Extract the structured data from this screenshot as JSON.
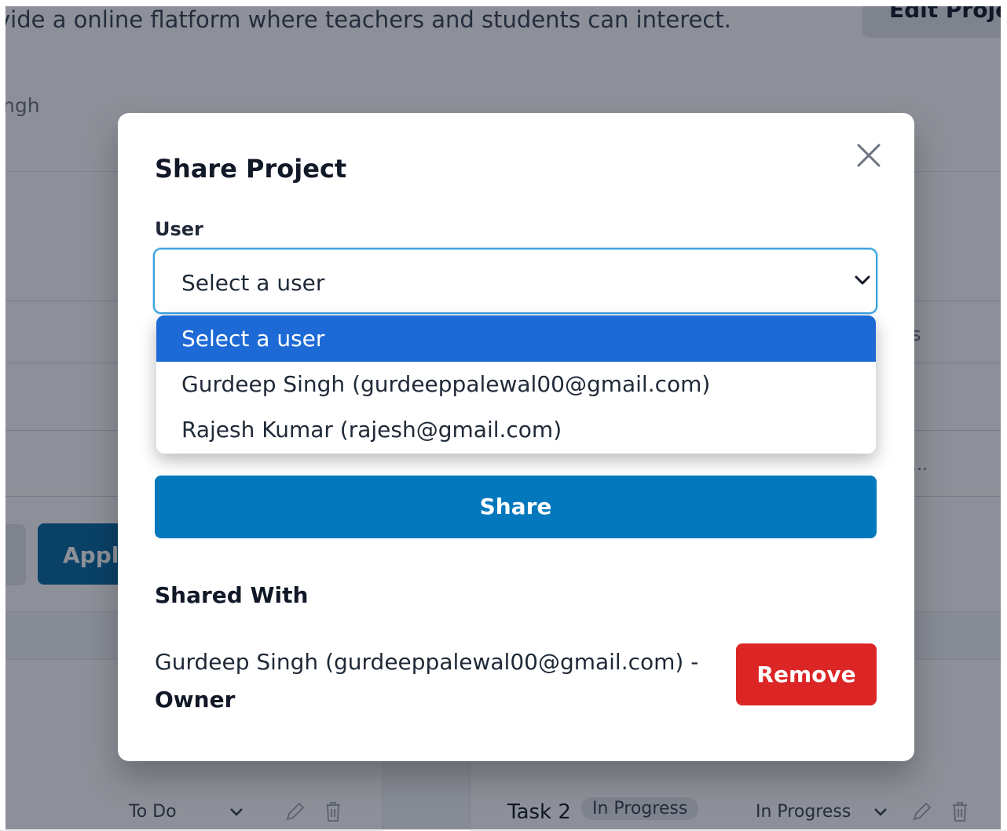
{
  "background": {
    "project_description": "vide a online flatform where teachers and students can interect.",
    "owner_fragment": "ngh",
    "edit_button": "Edit Proje",
    "status_fragment": "s",
    "dots_fragment": "...",
    "apply_button": "Appl",
    "tasks": [
      {
        "status_label": "To Do"
      },
      {
        "name": "Task 2",
        "badge": "In Progress",
        "status_label": "In Progress"
      }
    ]
  },
  "modal": {
    "title": "Share Project",
    "user_label": "User",
    "select": {
      "selected": "Select a user",
      "options": [
        "Select a user",
        "Gurdeep Singh (gurdeeppalewal00@gmail.com)",
        "Rajesh Kumar (rajesh@gmail.com)"
      ]
    },
    "share_button": "Share",
    "shared_with_heading": "Shared With",
    "shared_with": [
      {
        "text": "Gurdeep Singh (gurdeeppalewal00@gmail.com) -",
        "role": "Owner",
        "remove_label": "Remove"
      }
    ]
  },
  "icons": {
    "close": "close-icon",
    "chevron": "chevron-down-icon",
    "edit": "pencil-icon",
    "delete": "trash-icon"
  },
  "colors": {
    "share_button": "#0378bd",
    "remove_button": "#dc2626",
    "selected_option": "#1d69d6",
    "select_focus_border": "#38a3e0"
  }
}
